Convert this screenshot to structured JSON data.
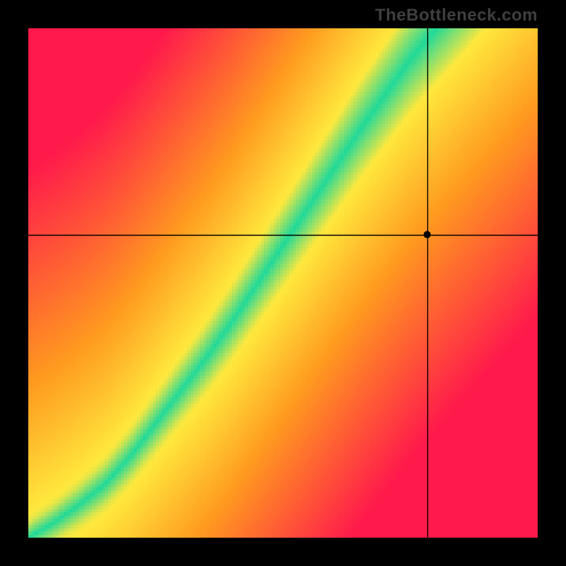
{
  "watermark": "TheBottleneck.com",
  "chart_data": {
    "type": "heatmap",
    "title": "",
    "xlabel": "",
    "ylabel": "",
    "xlim": [
      0,
      1
    ],
    "ylim": [
      0,
      1
    ],
    "grid": false,
    "legend": false,
    "crosshair": {
      "x": 0.783,
      "y": 0.595
    },
    "marker": {
      "x": 0.783,
      "y": 0.595
    },
    "ridge_points": [
      {
        "x": 0.0,
        "y": 0.0
      },
      {
        "x": 0.05,
        "y": 0.03
      },
      {
        "x": 0.1,
        "y": 0.065
      },
      {
        "x": 0.15,
        "y": 0.105
      },
      {
        "x": 0.2,
        "y": 0.16
      },
      {
        "x": 0.25,
        "y": 0.225
      },
      {
        "x": 0.3,
        "y": 0.29
      },
      {
        "x": 0.35,
        "y": 0.355
      },
      {
        "x": 0.4,
        "y": 0.425
      },
      {
        "x": 0.45,
        "y": 0.5
      },
      {
        "x": 0.5,
        "y": 0.575
      },
      {
        "x": 0.55,
        "y": 0.65
      },
      {
        "x": 0.6,
        "y": 0.725
      },
      {
        "x": 0.65,
        "y": 0.8
      },
      {
        "x": 0.7,
        "y": 0.87
      },
      {
        "x": 0.75,
        "y": 0.94
      },
      {
        "x": 0.8,
        "y": 1.0
      }
    ],
    "ridge_width_base": 0.03,
    "ridge_width_slope": 0.08,
    "top_left_color": "#ff1a4b",
    "bottom_right_color": "#ff1a4b",
    "mid_color": "#ff9a1f",
    "near_ridge_color": "#ffe83d",
    "ridge_color": "#1fd99a",
    "resolution": 160
  }
}
